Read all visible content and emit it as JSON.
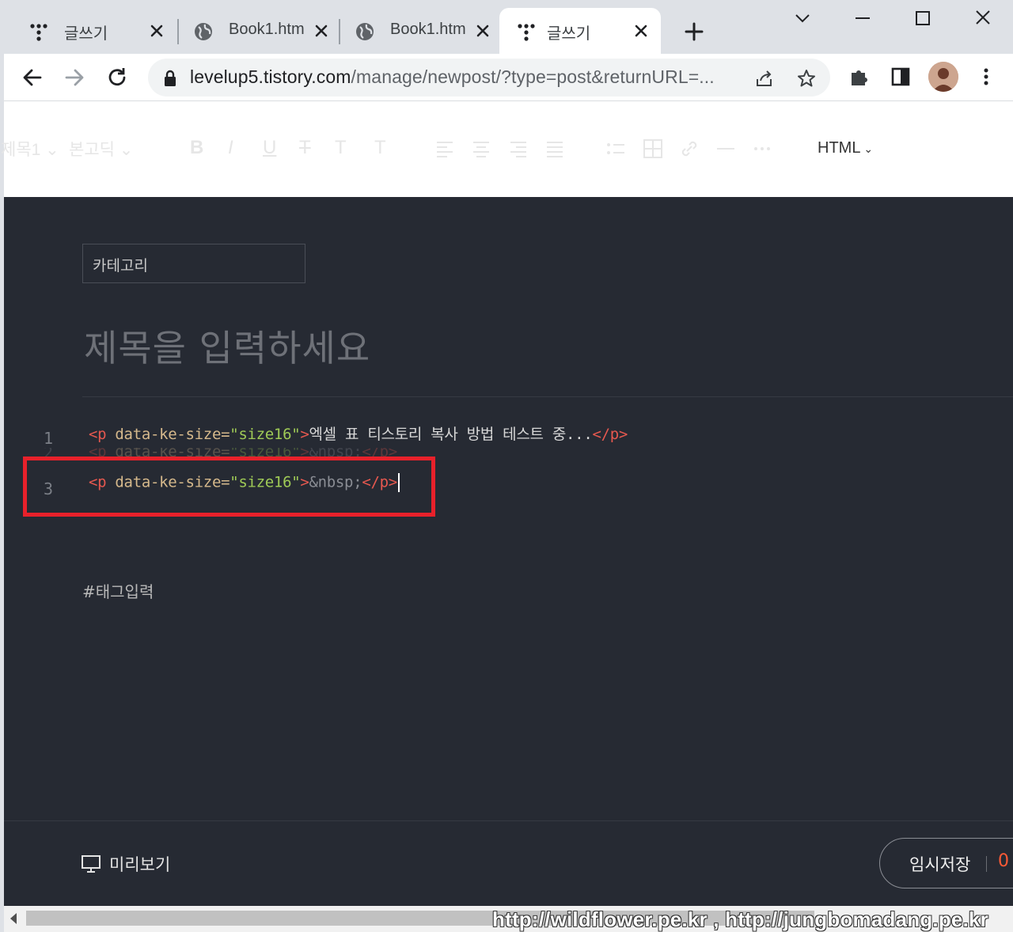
{
  "browser": {
    "tabs": [
      {
        "title": "글쓰기",
        "icon": "tistory-icon"
      },
      {
        "title": "Book1.htm",
        "icon": "globe-icon"
      },
      {
        "title": "Book1.htm",
        "icon": "globe-icon"
      },
      {
        "title": "글쓰기",
        "icon": "tistory-icon"
      }
    ],
    "url_host": "levelup5.tistory.com",
    "url_path": "/manage/newpost/?type=post&returnURL=..."
  },
  "editor_toolbar": {
    "heading": "제목1",
    "font": "본고딕",
    "bold": "B",
    "italic": "I",
    "underline": "U",
    "strike": "T",
    "text_color": "T",
    "bg_color": "T",
    "mode": "HTML"
  },
  "post": {
    "category_placeholder": "카테고리",
    "title_placeholder": "제목을 입력하세요",
    "tag_placeholder": "#태그입력",
    "code_lines": [
      {
        "number": "1",
        "open": "<p ",
        "attr": "data-ke-size=",
        "value": "\"size16\"",
        "close_open": ">",
        "text": "엑셀 표 티스토리 복사 방법 테스트 중...",
        "close": "</p>"
      },
      {
        "number": "2",
        "open": "<p ",
        "attr": "data-ke-size=",
        "value": "\"size16\"",
        "close_open": ">",
        "text": "&nbsp;",
        "close": "</p>"
      },
      {
        "number": "3",
        "open": "<p ",
        "attr": "data-ke-size=",
        "value": "\"size16\"",
        "close_open": ">",
        "text": "&nbsp;",
        "close": "</p>"
      }
    ]
  },
  "footer": {
    "preview_label": "미리보기",
    "save_label": "임시저장",
    "save_count": "0"
  },
  "watermark": "http://wildflower.pe.kr , http://jungbomadang.pe.kr",
  "colors": {
    "editor_bg": "#262a33",
    "highlight": "#e8212b",
    "tag": "#e6584f",
    "value": "#9fca56",
    "accent": "#ff5a36"
  }
}
